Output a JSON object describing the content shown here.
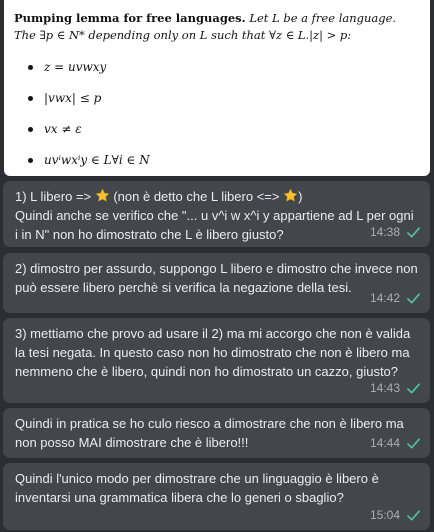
{
  "lemma": {
    "title": "Pumping lemma for free languages.",
    "statement": "Let L be a free language. The ∃p ∈ N* depending only on L such that ∀z ∈ L.|z| > p:",
    "conditions": [
      "z = uvwxy",
      "|vwx| ≤ p",
      "vx ≠ ε",
      "uvⁱwxⁱy ∈ L∀i ∈ N"
    ]
  },
  "messages": [
    {
      "text_before_star1": "1) L libero => ",
      "text_between_stars": " (non è detto che L libero <=> ",
      "text_after_star2": ")\nQuindi anche se verifico che \"... u v^i w x^i y appartiene ad L per ogni i in N\" non ho dimostrato che L è libero giusto?",
      "time": "14:38"
    },
    {
      "text": "2) dimostro per assurdo, suppongo L libero e dimostro che invece non può essere libero perchè si verifica la negazione della tesi.",
      "time": "14:42"
    },
    {
      "text": "3) mettiamo che provo ad usare il 2) ma mi accorgo che non è valida la tesi negata. In questo caso non ho dimostrato che non è libero ma nemmeno che è libero, quindi non ho dimostrato un cazzo, giusto?",
      "time": "14:43"
    },
    {
      "text": "Quindi in pratica se ho culo riesco a dimostrare che non è libero ma non posso MAI dimostrare che è libero!!!",
      "time": "14:44"
    },
    {
      "text": "Quindi l'unico modo per dimostrare che un linguaggio è libero è inventarsi una grammatica libera che lo generi o sbaglio?",
      "time": "15:04"
    }
  ],
  "colors": {
    "background": "#2b2f33",
    "bubble": "#43474c",
    "text": "#e9edef",
    "timestamp": "#a9b0b6",
    "read_check": "#4fc3a1",
    "star": "#f7c325"
  }
}
